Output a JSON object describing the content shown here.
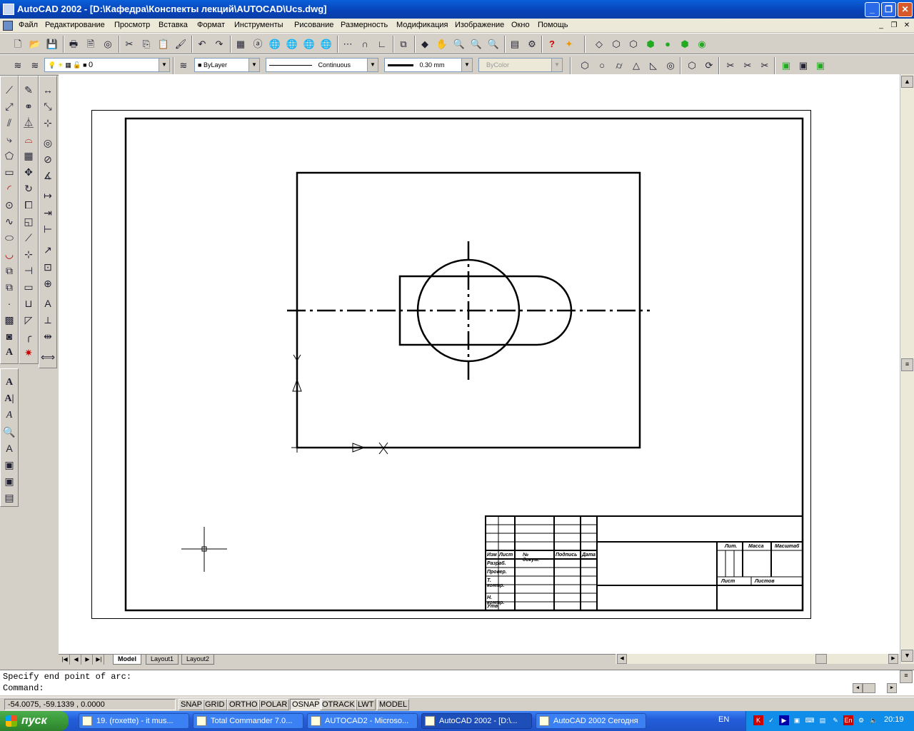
{
  "window": {
    "title": "AutoCAD 2002 - [D:\\Кафедра\\Конспекты лекций\\AUTOCAD\\Ucs.dwg]",
    "caption_buttons": [
      "_",
      "❐",
      "✕"
    ]
  },
  "menu": {
    "items": [
      "Файл",
      "Редактирование",
      "Просмотр",
      "Вставка",
      "Формат",
      "Инструменты",
      "Рисование",
      "Размерность",
      "Модификация",
      "Изображение",
      "Окно",
      "Помощь"
    ],
    "mdi_buttons": [
      "_",
      "❐",
      "✕"
    ]
  },
  "properties": {
    "layer": "0",
    "color": "ByLayer",
    "linetype": "Continuous",
    "lineweight": "0.30 mm",
    "plotstyle": "ByColor"
  },
  "layout_tabs": [
    "Model",
    "Layout1",
    "Layout2"
  ],
  "active_tab": "Model",
  "title_block": {
    "labels": [
      "Изм",
      "Лист",
      "№ докум.",
      "Подпись",
      "Дата",
      "Разраб.",
      "Провер.",
      "Т. контр.",
      "Н. контр.",
      "Утв.",
      "Лит.",
      "Масса",
      "Масштаб",
      "Лист",
      "Листов"
    ]
  },
  "command": {
    "line1": "Specify end point of arc:",
    "line2": "Command:"
  },
  "status": {
    "coords": "-54.0075, -59.1339 , 0.0000",
    "buttons": [
      {
        "label": "SNAP",
        "on": false
      },
      {
        "label": "GRID",
        "on": false
      },
      {
        "label": "ORTHO",
        "on": false
      },
      {
        "label": "POLAR",
        "on": false
      },
      {
        "label": "OSNAP",
        "on": true
      },
      {
        "label": "OTRACK",
        "on": false
      },
      {
        "label": "LWT",
        "on": false
      },
      {
        "label": "MODEL",
        "on": false
      }
    ]
  },
  "taskbar": {
    "start": "пуск",
    "tasks": [
      "19. (roxette) - it mus...",
      "Total Commander 7.0...",
      "AUTOCAD2 - Microso...",
      "AutoCAD 2002 - [D:\\...",
      "AutoCAD 2002 Сегодня"
    ],
    "active_task": 3,
    "lang": "EN",
    "clock": "20:19"
  }
}
